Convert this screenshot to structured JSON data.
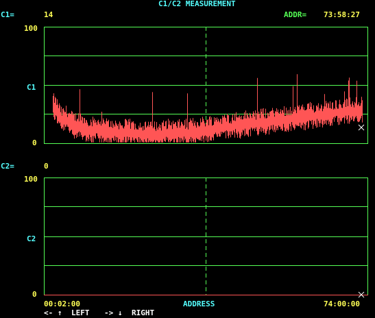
{
  "title": "C1/C2 MEASUREMENT",
  "c1": {
    "label": "C1=",
    "value": "14"
  },
  "addr": {
    "label": "ADDR=",
    "value": "73:58:27"
  },
  "c2": {
    "label": "C2=",
    "value": "0"
  },
  "upper_plot": {
    "y_top_label": "100",
    "y_mid_label": "C1",
    "y_bottom_label": "0",
    "trace_color": "#ff5555"
  },
  "lower_plot": {
    "y_top_label": "100",
    "y_mid_label": "C2",
    "y_bottom_label": "0",
    "trace_color": "#ff5555"
  },
  "x_axis": {
    "start": "00:02:00",
    "label": "ADDRESS",
    "end": "74:00:00"
  },
  "nav": {
    "left_keys": "<- ↑",
    "left_label": "LEFT",
    "right_keys": "-> ↓",
    "right_label": "RIGHT"
  },
  "colors": {
    "grid": "#55ff55",
    "label_cyan": "#55ffff",
    "value_yellow": "#ffff55",
    "trace": "#ff5555",
    "background": "#000000"
  },
  "chart_data": [
    {
      "type": "line",
      "series": [
        {
          "values": [
            35,
            30,
            22,
            24,
            20,
            18,
            19,
            16,
            15,
            14,
            16,
            13,
            14,
            12,
            13,
            12,
            11,
            13,
            12,
            11,
            12,
            10,
            11,
            12,
            10,
            11,
            12,
            13,
            11,
            12,
            13,
            12,
            14,
            13,
            15,
            14,
            16,
            15,
            17,
            16,
            18,
            17,
            19,
            18,
            20,
            19,
            21,
            20,
            22,
            21,
            22,
            23,
            22,
            24,
            23,
            25,
            24,
            26,
            25,
            27,
            26,
            28,
            27,
            29,
            28,
            30,
            29,
            30,
            31,
            30,
            32,
            31
          ]
        }
      ],
      "ylim": [
        0,
        100
      ]
    },
    {
      "type": "line",
      "series": [
        {
          "values": [
            0,
            0,
            0,
            0,
            0,
            0,
            0,
            0,
            0,
            0,
            0,
            0
          ]
        }
      ],
      "ylim": [
        0,
        100
      ]
    }
  ]
}
